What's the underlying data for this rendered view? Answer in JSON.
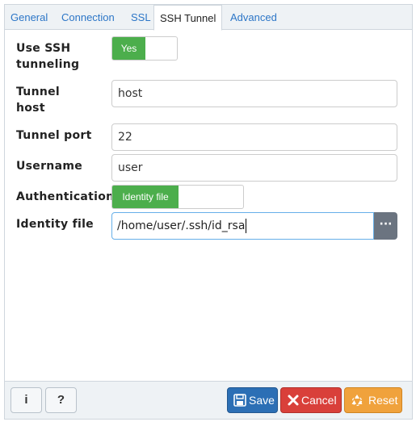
{
  "tabs": [
    {
      "label": "General"
    },
    {
      "label": "Connection"
    },
    {
      "label": "SSL"
    },
    {
      "label": "SSH Tunnel"
    },
    {
      "label": "Advanced"
    }
  ],
  "active_tab": "SSH Tunnel",
  "form": {
    "use_ssh": {
      "label_line1": "Use SSH",
      "label_line2": "tunneling",
      "value": "Yes"
    },
    "tunnel_host": {
      "label_line1": "Tunnel",
      "label_line2": "host",
      "value": "host"
    },
    "tunnel_port": {
      "label": "Tunnel port",
      "value": "22"
    },
    "username": {
      "label": "Username",
      "value": "user"
    },
    "authentication": {
      "label": "Authentication",
      "value": "Identity file"
    },
    "identity_file": {
      "label": "Identity file",
      "value": "/home/user/.ssh/id_rsa",
      "browse_label": "···"
    }
  },
  "footer": {
    "info_label": "i",
    "help_label": "?",
    "save_label": "Save",
    "cancel_label": "Cancel",
    "reset_label": "Reset"
  },
  "colors": {
    "accent": "#2c76c7",
    "switch_on": "#4cae4c",
    "save": "#2c6fb5",
    "cancel": "#d9403a",
    "reset": "#f0a23c"
  }
}
